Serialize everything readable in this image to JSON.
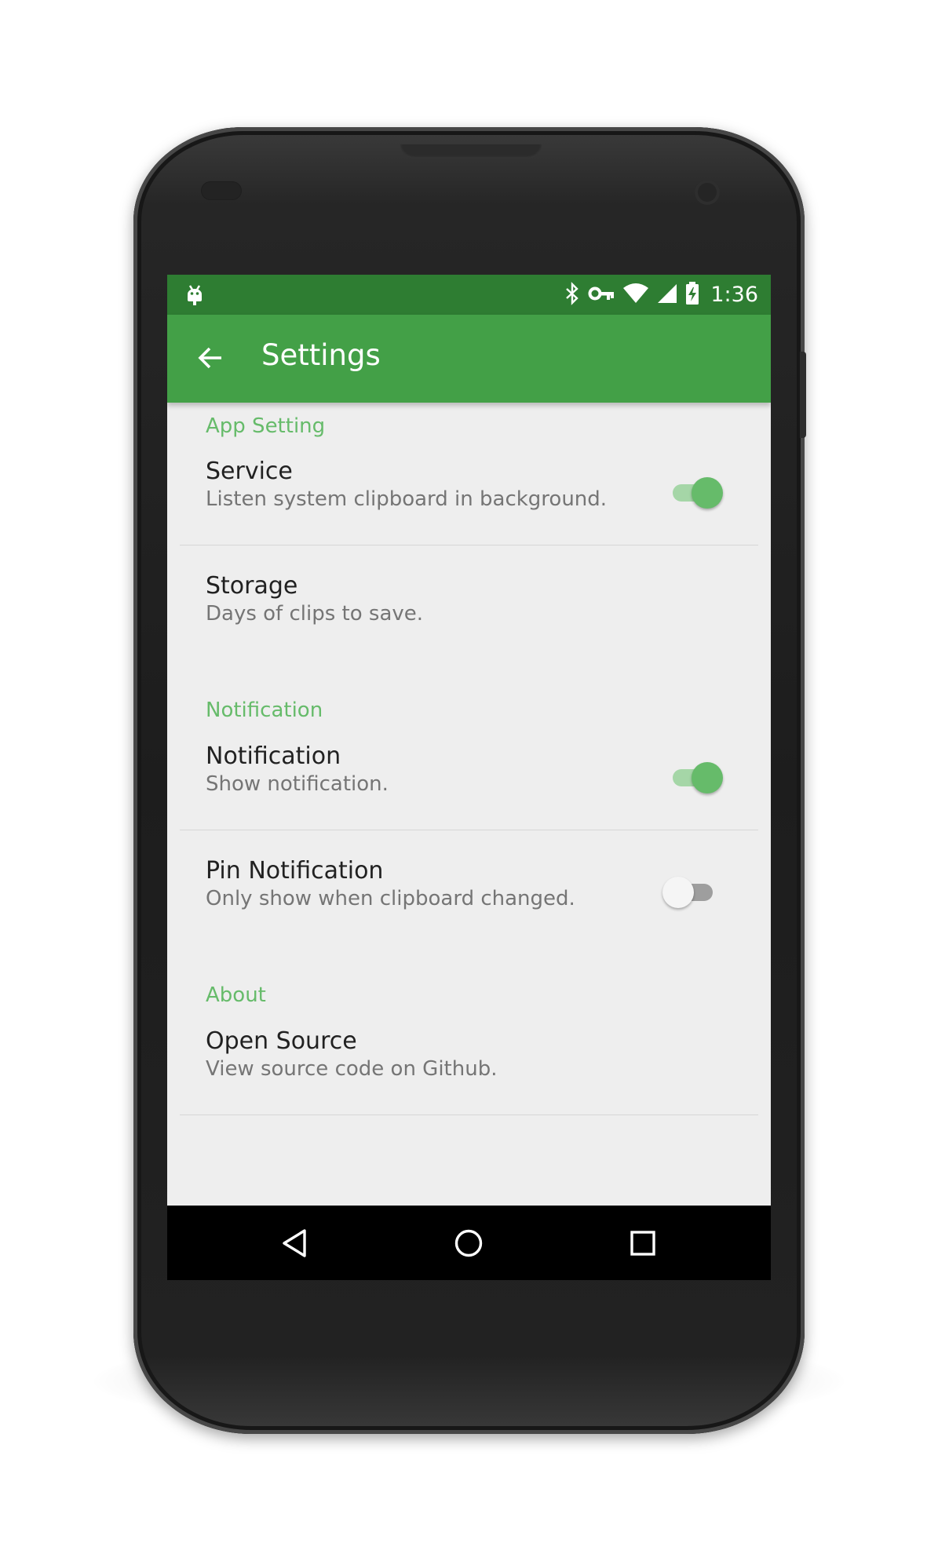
{
  "status_bar": {
    "time": "1:36",
    "icons": [
      "android-debug-icon",
      "bluetooth-icon",
      "vpn-key-icon",
      "wifi-icon",
      "cell-signal-icon",
      "battery-charging-icon"
    ]
  },
  "toolbar": {
    "back_icon": "arrow-back-icon",
    "title": "Settings"
  },
  "sections": {
    "app_setting": {
      "header": "App Setting",
      "service": {
        "title": "Service",
        "summary": "Listen system clipboard in background.",
        "enabled": true
      },
      "storage": {
        "title": "Storage",
        "summary": "Days of clips to save."
      }
    },
    "notification": {
      "header": "Notification",
      "notification": {
        "title": "Notification",
        "summary": "Show notification.",
        "enabled": true
      },
      "pin_notification": {
        "title": "Pin Notification",
        "summary": "Only show when clipboard changed.",
        "enabled": false
      }
    },
    "about": {
      "header": "About",
      "open_source": {
        "title": "Open Source",
        "summary": "View source code on Github."
      }
    }
  },
  "nav_bar": {
    "back": "nav-back-icon",
    "home": "nav-home-icon",
    "recents": "nav-recents-icon"
  },
  "colors": {
    "status_bar": "#2e7d32",
    "toolbar": "#43a047",
    "accent": "#66bb6a",
    "background": "#eeeeee"
  }
}
